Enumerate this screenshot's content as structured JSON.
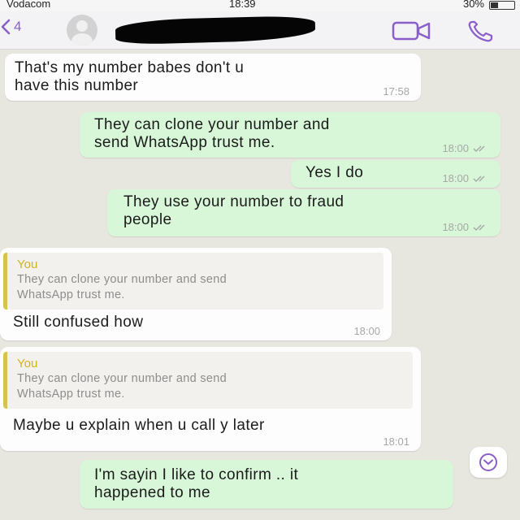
{
  "status_bar": {
    "carrier": "Vodacom",
    "time": "18:39",
    "battery": "30%"
  },
  "header": {
    "back_count": "4",
    "icons": [
      "back-chevron-icon",
      "avatar",
      "video-camera-icon",
      "phone-icon"
    ]
  },
  "messages": [
    {
      "direction": "in",
      "text": "That's my number babes don't u\nhave this number",
      "time": "17:58"
    },
    {
      "direction": "out",
      "text": "They can clone your number and\nsend WhatsApp trust me.",
      "time": "18:00"
    },
    {
      "direction": "out",
      "text": "Yes I do",
      "time": "18:00"
    },
    {
      "direction": "out",
      "text": "They use your number to fraud\npeople",
      "time": "18:00"
    },
    {
      "direction": "in",
      "quote_author": "You",
      "quote_text": "They can clone your number and send\nWhatsApp trust me.",
      "text": "Still confused how",
      "time": "18:00"
    },
    {
      "direction": "in",
      "quote_author": "You",
      "quote_text": "They can clone your number and send\nWhatsApp trust me.",
      "text": "Maybe u explain when u call y later",
      "time": "18:01"
    },
    {
      "direction": "out",
      "text": "I'm sayin I like to confirm .. it\nhappened to me",
      "time": ""
    }
  ],
  "colors": {
    "accent": "#8a5fc9",
    "outgoing_bubble": "#d8f6d8",
    "incoming_bubble": "#fdfdfd",
    "quote_bar": "#d8c34a",
    "chat_background": "#e7e6df"
  }
}
